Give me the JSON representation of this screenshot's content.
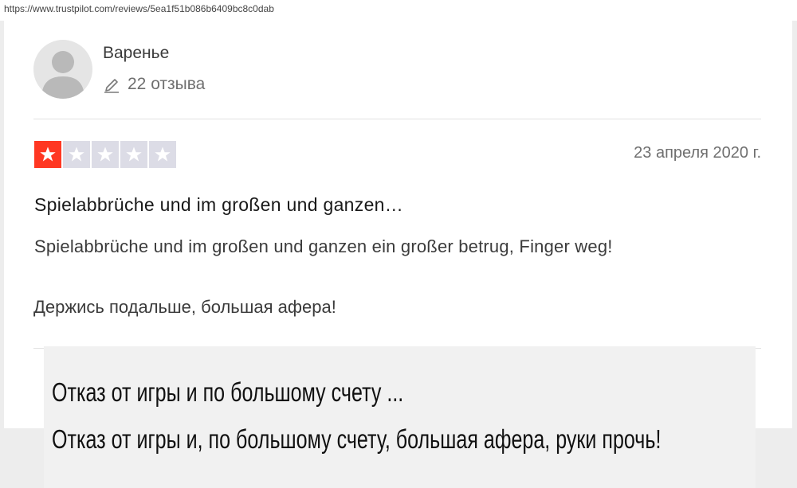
{
  "browser": {
    "url": "https://www.trustpilot.com/reviews/5ea1f51b086b6409bc8c0dab"
  },
  "reviewer": {
    "avatar_icon": "user-silhouette-icon",
    "name": "Варенье",
    "reviews_icon": "pencil-icon",
    "reviews_count": "22 отзыва"
  },
  "review": {
    "rating": 1,
    "max_rating": 5,
    "colors": {
      "star_filled_bg": "#ff3722",
      "star_empty_bg": "#dcdce6",
      "star_glyph": "#ffffff"
    },
    "date": "23 апреля 2020 г.",
    "title": "Spielabbrüche und im großen und ganzen…",
    "body": "Spielabbrüche und im großen und ganzen ein großer betrug, Finger weg!",
    "translation": "Держись подальше, большая афера!"
  },
  "overlay": {
    "line1": "Отказ от игры и по большому счету ...",
    "line2": "Отказ от игры и, по большому счету, большая афера, руки прочь!"
  }
}
